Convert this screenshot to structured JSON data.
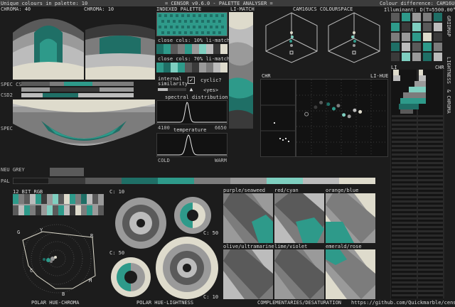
{
  "header": {
    "unique_colours": "Unique colours in palette: 10",
    "app_title": "= CENSOR v0.6.0 - PALETTE ANALYSER =",
    "colour_difference": "Colour difference: CAM16UCS",
    "illuminant": "Illuminant: D(T=5500.00°K)"
  },
  "section_labels": {
    "chroma_40": "CHROMA: 40",
    "chroma_10": "CHROMA: 10",
    "indexed_palette": "INDEXED PALETTE",
    "li_match": "LI-MATCH",
    "cam16ucs": "CAM16UCS COLOURSPACE",
    "li": "LI",
    "chr": "CHR",
    "chr_plot": "CHR",
    "li_hue": "LI-HUE",
    "spec_csd1": "SPEC CSD1",
    "spec_csd2": "CSD2",
    "spec_sdd": "SPEC SDD",
    "neu_grey": "NEU GREY",
    "pal": "PAL",
    "twelve_bit": "12 BIT RGB",
    "close_10": "close cols: 10% li-match",
    "close_70": "close cols: 70% li-match",
    "internal_similarity": "internal similarity",
    "cyclic": "cyclic?",
    "cyclic_value": "<yes>",
    "spectral_distribution": "spectral distribution",
    "spec_min": "4100",
    "spec_max": "6650",
    "temperature": "temperature",
    "cold": "COLD",
    "warm": "WARM",
    "c10a": "C: 10",
    "c50a": "C: 50",
    "c50b": "C: 50",
    "c10b": "C: 10",
    "polar_hue_chroma": "POLAR HUE-CHROMA",
    "polar_hue_lightness": "POLAR HUE-LIGHTNESS",
    "complementaries": "COMPLEMENTARIES/DESATURATION",
    "url": "https://github.com/Quickmarble/censor",
    "side_gridmap": "GRIDMAP",
    "side_lightness": "LIGHTNESS",
    "side_chroma": "& CHROMA"
  },
  "hue_letters": {
    "g": "G",
    "y": "Y",
    "r": "R",
    "c": "C",
    "m": "M",
    "b": "B"
  },
  "complementary_pairs": [
    "purple/seaweed",
    "red/cyan",
    "orange/blue",
    "olive/ultramarine",
    "lime/violet",
    "emerald/rose"
  ],
  "palette": [
    "#1c1c1c",
    "#3a3a3a",
    "#5a5a5a",
    "#7c7c7c",
    "#9a9a9a",
    "#bcbcbc",
    "#dedbcc",
    "#1f6f66",
    "#2e9a8a",
    "#7fcfc0"
  ],
  "colors": {
    "teal": "#2e9a8a",
    "dark_teal": "#1f6f66",
    "light_teal": "#7fcfc0",
    "cream": "#dedbcc",
    "accent_green": "#3fd0b0"
  },
  "cyclic_checked": true,
  "similarity_level": 0.35,
  "spectral_peak_nm": 5200,
  "temperature_peak_fraction": 0.45,
  "chart_data": [
    {
      "type": "scatter",
      "title": "LI-HUE",
      "points": [
        {
          "x": 0.11,
          "y": 0.55
        },
        {
          "x": 0.21,
          "y": 0.64
        },
        {
          "x": 0.27,
          "y": 0.7
        },
        {
          "x": 0.35,
          "y": 0.68
        },
        {
          "x": 0.41,
          "y": 0.62
        },
        {
          "x": 0.46,
          "y": 0.66
        },
        {
          "x": 0.52,
          "y": 0.54
        },
        {
          "x": 0.58,
          "y": 0.52
        },
        {
          "x": 0.64,
          "y": 0.6
        },
        {
          "x": 0.7,
          "y": 0.58
        }
      ]
    }
  ]
}
